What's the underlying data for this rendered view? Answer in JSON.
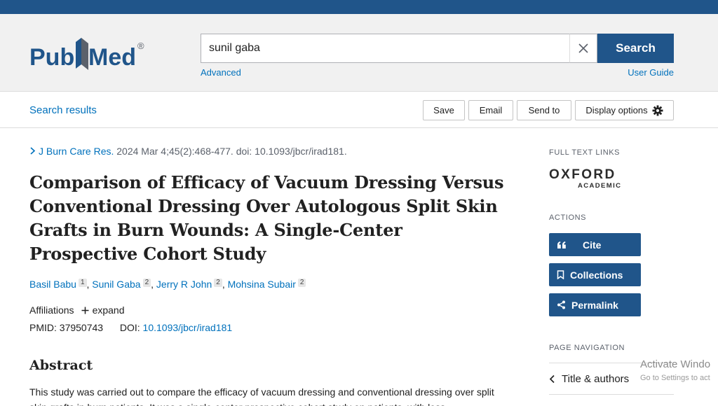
{
  "brand": {
    "logo_text_left": "Pub",
    "logo_text_right": "Med",
    "registered": "®",
    "colors": {
      "primary": "#20558a",
      "link": "#0071bc"
    }
  },
  "search": {
    "value": "sunil gaba",
    "button_label": "Search",
    "advanced_label": "Advanced",
    "user_guide_label": "User Guide"
  },
  "toolbar": {
    "search_results_label": "Search results",
    "save_label": "Save",
    "email_label": "Email",
    "send_to_label": "Send to",
    "display_options_label": "Display options"
  },
  "article": {
    "journal": "J Burn Care Res.",
    "citation": "2024 Mar 4;45(2):468-477. doi: 10.1093/jbcr/irad181.",
    "title": "Comparison of Efficacy of Vacuum Dressing Versus Conventional Dressing Over Autologous Split Skin Grafts in Burn Wounds: A Single-Center Prospective Cohort Study",
    "authors": [
      {
        "name": "Basil Babu",
        "affil": "1"
      },
      {
        "name": "Sunil Gaba",
        "affil": "2"
      },
      {
        "name": "Jerry R John",
        "affil": "2"
      },
      {
        "name": "Mohsina Subair",
        "affil": "2"
      }
    ],
    "affiliations_label": "Affiliations",
    "expand_label": "expand",
    "pmid_label": "PMID:",
    "pmid": "37950743",
    "doi_label": "DOI:",
    "doi": "10.1093/jbcr/irad181",
    "abstract_heading": "Abstract",
    "abstract_text": "This study was carried out to compare the efficacy of vacuum dressing and conventional dressing over split skin grafts in burn patients. It was a single-center prospective cohort study on patients, with less"
  },
  "sidebar": {
    "full_text_links_label": "FULL TEXT LINKS",
    "oxford_line1": "OXFORD",
    "oxford_line2": "ACADEMIC",
    "actions_label": "ACTIONS",
    "cite_label": "Cite",
    "collections_label": "Collections",
    "permalink_label": "Permalink",
    "page_navigation_label": "PAGE NAVIGATION",
    "title_authors_label": "Title & authors"
  },
  "watermark": {
    "line1": "Activate Windo",
    "line2": "Go to Settings to act"
  }
}
